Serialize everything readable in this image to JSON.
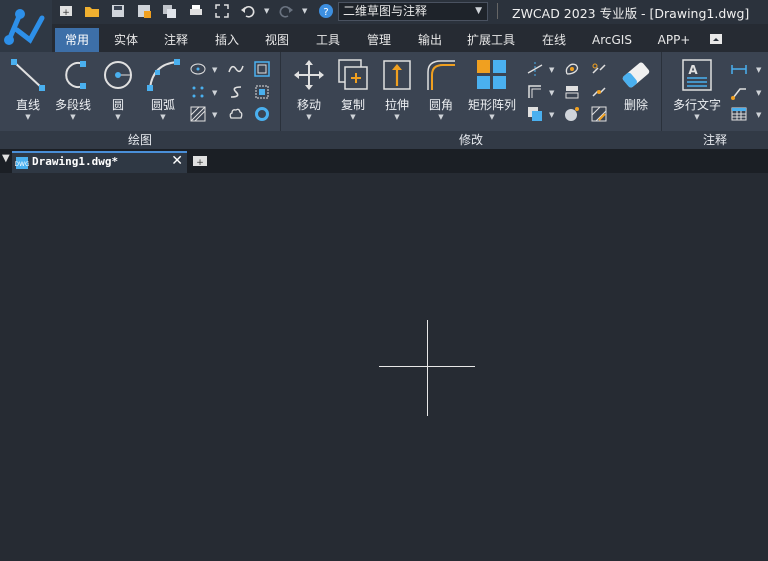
{
  "title_bar": {
    "workspace": "二维草图与注释",
    "window_title": "ZWCAD 2023 专业版 - [Drawing1.dwg]"
  },
  "ribbon_tabs": [
    "常用",
    "实体",
    "注释",
    "插入",
    "视图",
    "工具",
    "管理",
    "输出",
    "扩展工具",
    "在线",
    "ArcGIS",
    "APP+"
  ],
  "active_tab": "常用",
  "draw_panel": {
    "title": "绘图",
    "tools": [
      "直线",
      "多段线",
      "圆",
      "圆弧"
    ]
  },
  "modify_panel": {
    "title": "修改",
    "tools": [
      "移动",
      "复制",
      "拉伸",
      "圆角",
      "矩形阵列",
      "删除"
    ]
  },
  "annotation_panel": {
    "title": "注释",
    "tools": [
      "多行文字"
    ]
  },
  "document_tab": {
    "name": "Drawing1.dwg*"
  },
  "colors": {
    "accent": "#3d6fa8",
    "ribbon": "#3b4452",
    "canvas": "#262b33",
    "icon_blue": "#4ab0ef",
    "icon_orange": "#f0a020"
  }
}
